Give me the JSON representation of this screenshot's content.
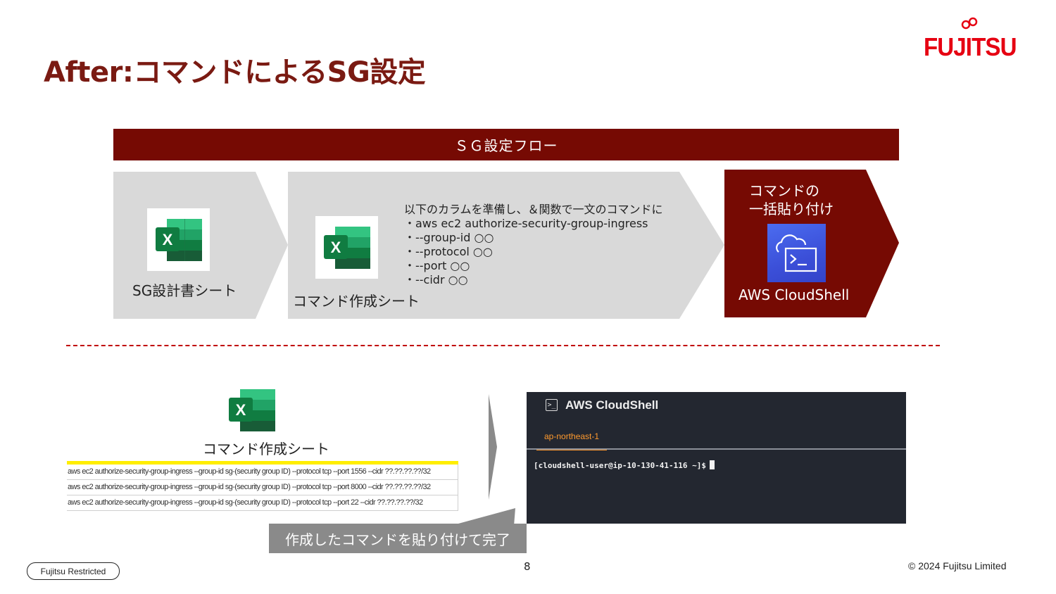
{
  "title": "After:コマンドによるSG設定",
  "logo": {
    "text": "FUJITSU",
    "color": "#e60012"
  },
  "flow": {
    "header": "ＳＧ設定フロー",
    "step1": {
      "label": "SG設計書シート",
      "icon": "excel-icon"
    },
    "step2": {
      "label": "コマンド作成シート",
      "icon": "excel-icon",
      "description": [
        "以下のカラムを準備し、＆関数で一文のコマンドに",
        "・aws ec2 authorize-security-group-ingress",
        "・--group-id ○○",
        "・--protocol ○○",
        "・--port ○○",
        "・--cidr ○○"
      ]
    },
    "step3": {
      "label_line1": "コマンドの",
      "label_line2": "一括貼り付け",
      "service_label": "AWS CloudShell",
      "icon": "cloudshell-icon"
    }
  },
  "bottom": {
    "sheet_label": "コマンド作成シート",
    "sheet_rows": [
      "aws ec2 authorize-security-group-ingress --group-id sg-(security group ID) --protocol tcp --port 1556 --cidr ??.??.??.??/32",
      "aws ec2 authorize-security-group-ingress --group-id sg-(security group ID) --protocol tcp --port 8000 --cidr ??.??.??.??/32",
      "aws ec2 authorize-security-group-ingress --group-id sg-(security group ID) --protocol tcp --port 22 --cidr ??.??.??.??/32"
    ],
    "terminal": {
      "title": "AWS CloudShell",
      "tab": "ap-northeast-1",
      "prompt": "[cloudshell-user@ip-10-130-41-116 ~]$"
    },
    "callout": "作成したコマンドを貼り付けて完了"
  },
  "footer": {
    "classification": "Fujitsu Restricted",
    "page": "8",
    "copyright": "© 2024 Fujitsu Limited"
  },
  "colors": {
    "accent": "#760a03",
    "title": "#7a1a12",
    "chevron_gray": "#d9d9d9",
    "divider": "#c00000",
    "excel_green": "#21a366"
  }
}
